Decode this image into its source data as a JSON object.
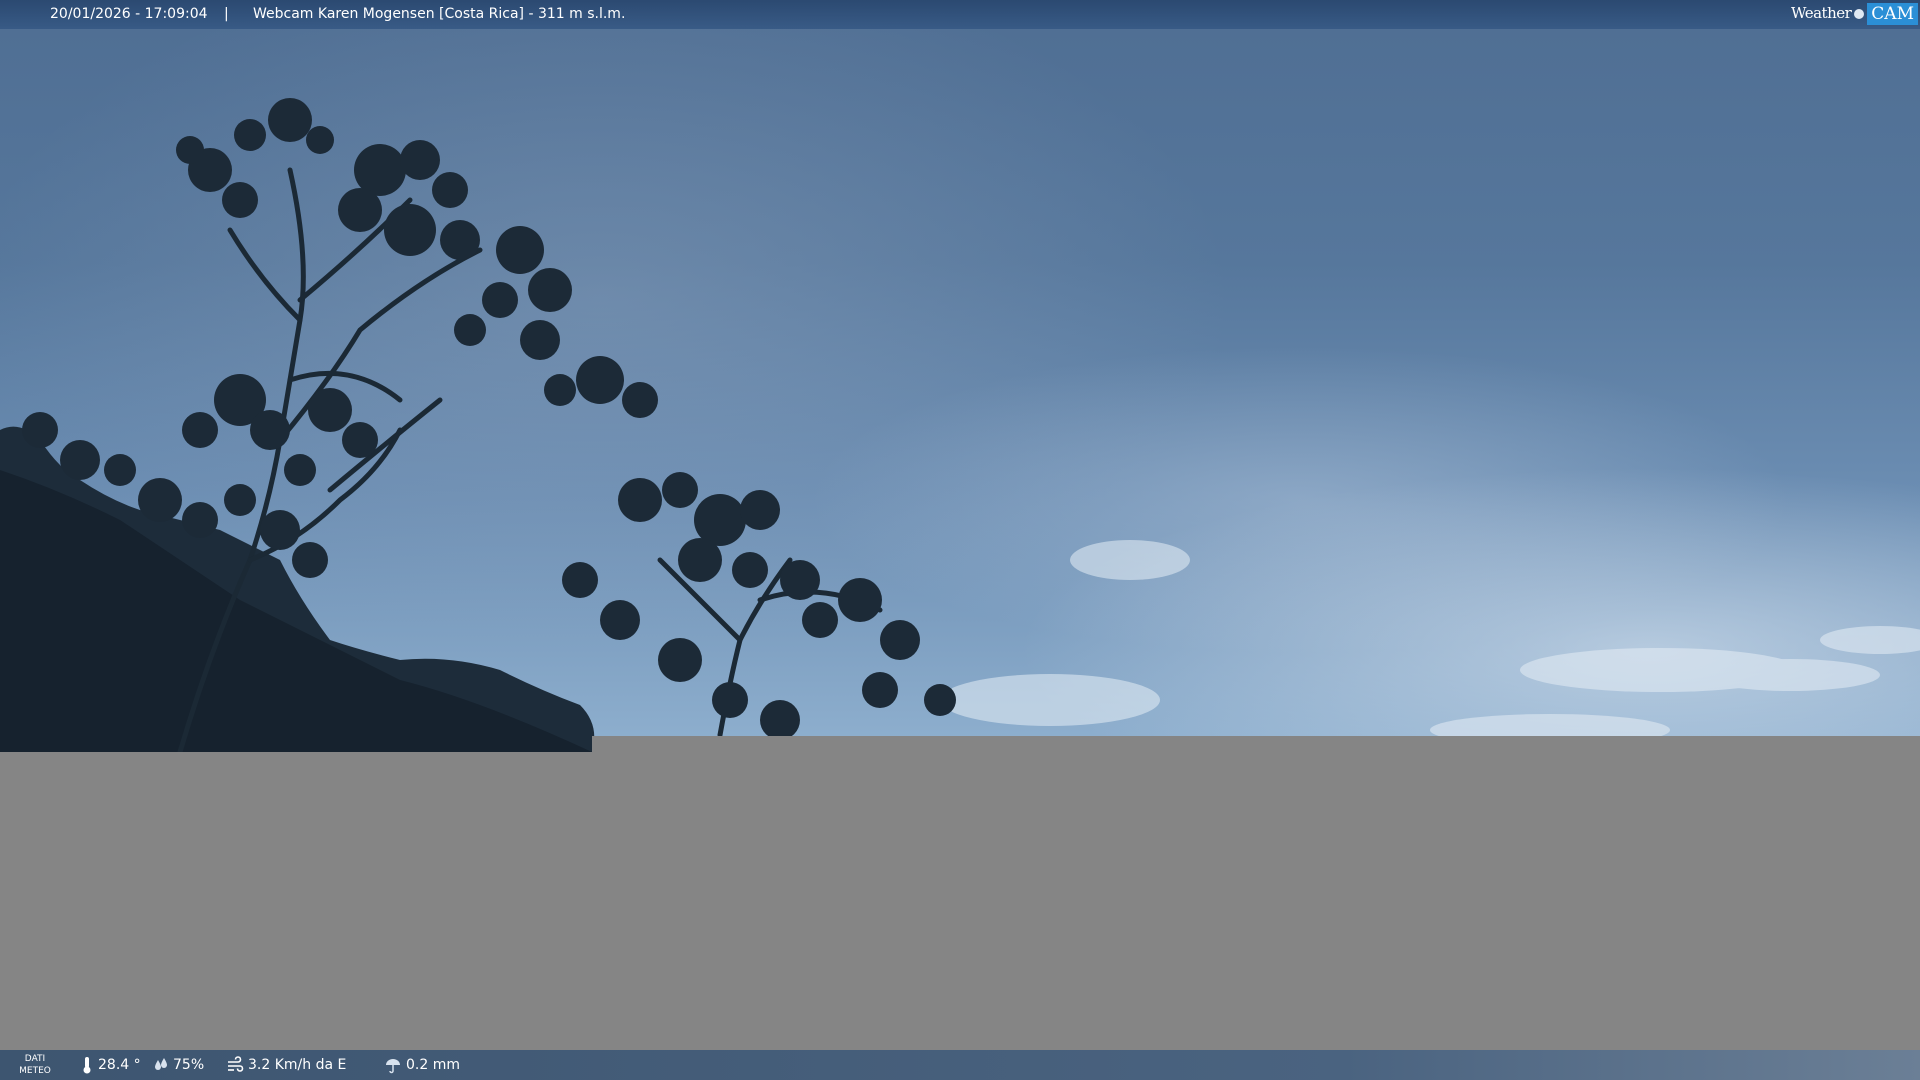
{
  "header": {
    "datetime": "20/01/2026 - 17:09:04",
    "separator": "|",
    "title": "Webcam Karen Mogensen [Costa Rica] - 311 m s.l.m.",
    "brand_weather": "Weather",
    "brand_cam": "CAM"
  },
  "weather_bar": {
    "dati_line1": "DATI",
    "dati_line2": "METEO",
    "temperature": "28.4 °",
    "humidity": "75%",
    "wind": "3.2 Km/h da E",
    "rain": "0.2 mm",
    "icons": {
      "temperature": "thermometer-icon",
      "humidity": "droplets-icon",
      "wind": "wind-icon",
      "rain": "rain-icon"
    }
  },
  "colors": {
    "sky_top": "#4f6e93",
    "sky_bottom": "#8fb0cf",
    "placeholder_gray": "#858585",
    "brand_accent": "#2b8fd6"
  }
}
